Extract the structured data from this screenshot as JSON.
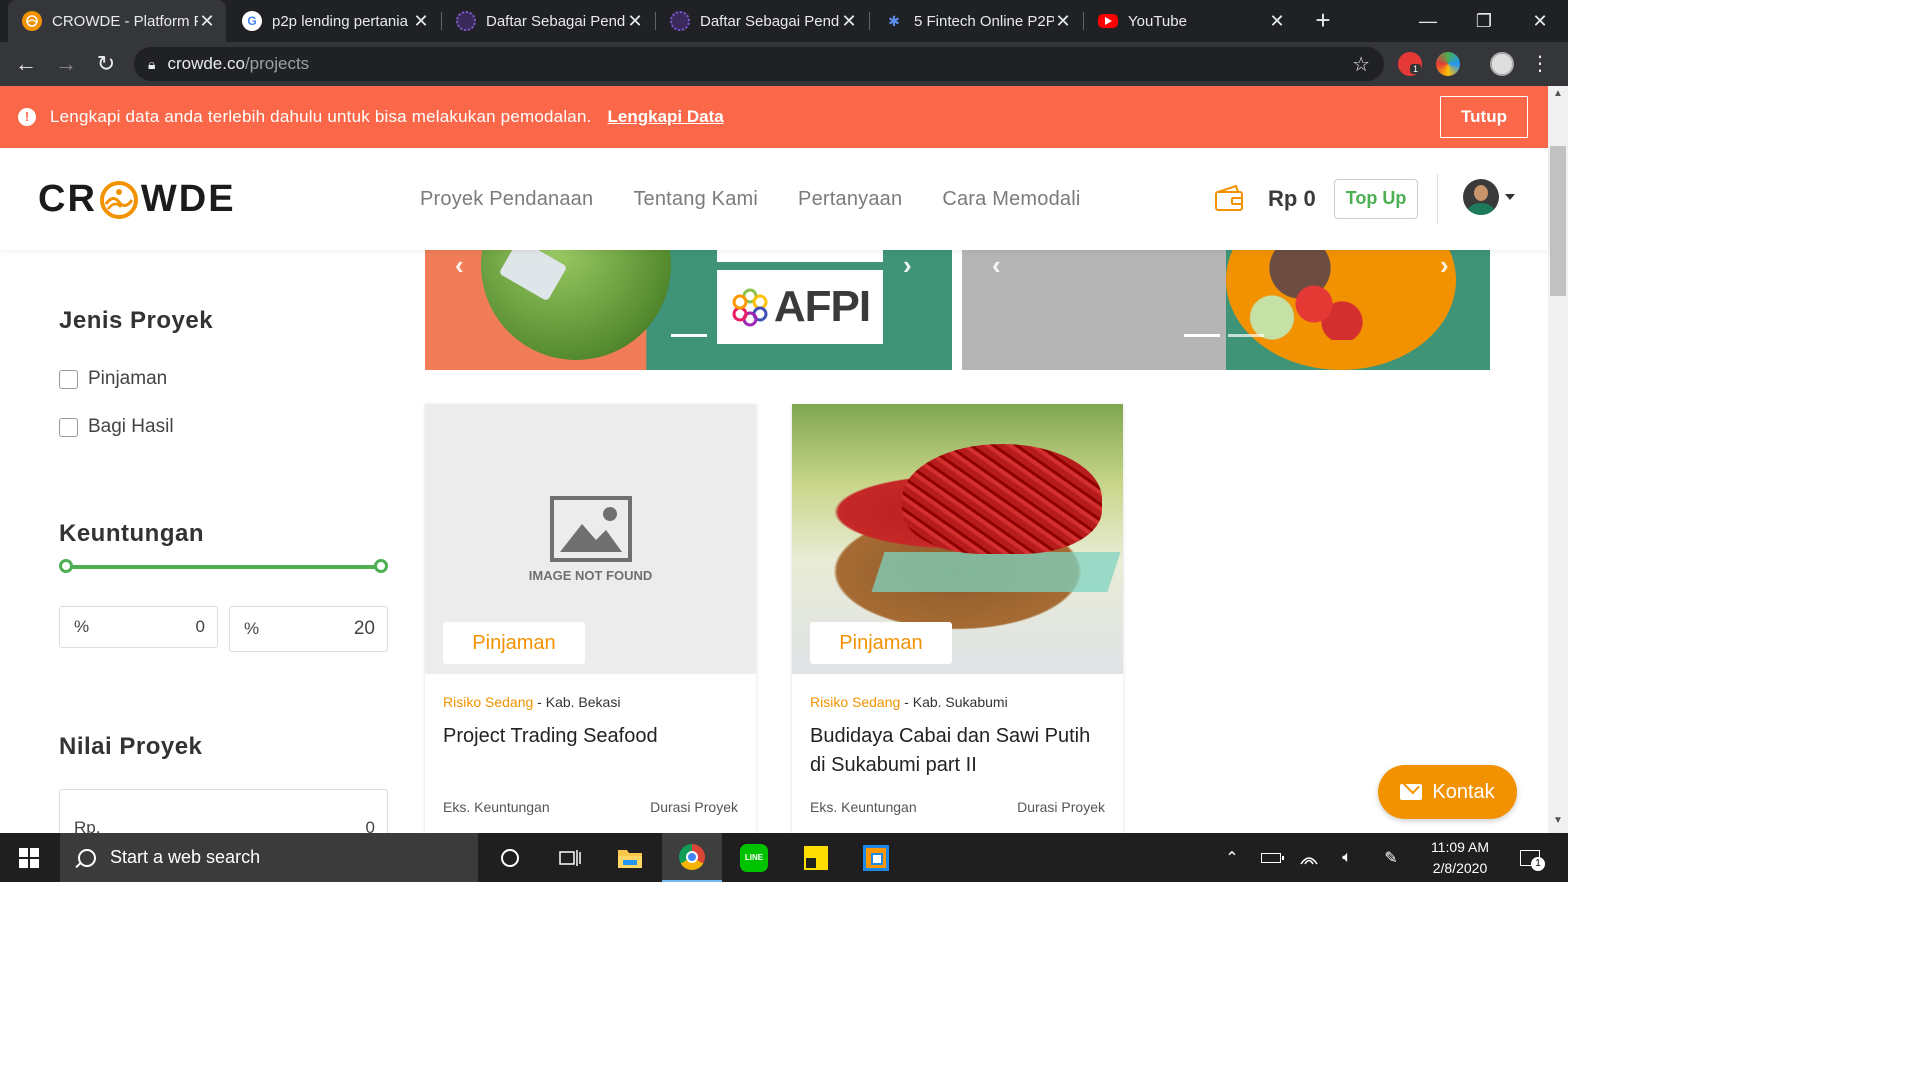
{
  "browser": {
    "tabs": [
      {
        "title": "CROWDE - Platform P",
        "icon": "crowde-favicon",
        "active": true
      },
      {
        "title": "p2p lending pertania",
        "icon": "google-icon",
        "active": false
      },
      {
        "title": "Daftar Sebagai Penda",
        "icon": "globe-icon",
        "active": false
      },
      {
        "title": "Daftar Sebagai Penda",
        "icon": "globe-icon",
        "active": false
      },
      {
        "title": "5 Fintech Online P2P",
        "icon": "fintech-icon",
        "active": false
      },
      {
        "title": "YouTube",
        "icon": "youtube-icon",
        "active": false
      }
    ],
    "url_host": "crowde.co",
    "url_path": "/projects",
    "extension_badge": "1"
  },
  "alert": {
    "message": "Lengkapi data anda terlebih dahulu untuk bisa melakukan pemodalan.",
    "link": "Lengkapi Data",
    "close": "Tutup"
  },
  "header": {
    "logo_left": "CR",
    "logo_right": "WDE",
    "nav": [
      "Proyek Pendanaan",
      "Tentang Kami",
      "Pertanyaan",
      "Cara Memodali"
    ],
    "balance": "Rp 0",
    "topup": "Top Up"
  },
  "filters": {
    "jenis_title": "Jenis Proyek",
    "jenis_options": [
      "Pinjaman",
      "Bagi Hasil"
    ],
    "keuntungan_title": "Keuntungan",
    "keuntungan_range": {
      "min": 0,
      "max": 20
    },
    "keuntungan_prefix": "%",
    "keuntungan_min_text": "0",
    "keuntungan_max_text": "20",
    "nilai_title": "Nilai Proyek",
    "nilai_prefix": "Rp.",
    "nilai_value": "0"
  },
  "banners": {
    "afpi_text": "AFPI"
  },
  "projects": [
    {
      "image": "image-not-found",
      "image_placeholder_text": "IMAGE NOT FOUND",
      "type": "Pinjaman",
      "risk": "Risiko Sedang",
      "location": "Kab. Bekasi",
      "title": "Project Trading Seafood",
      "profit_label": "Eks. Keuntungan",
      "duration_label": "Durasi Proyek"
    },
    {
      "image": "red-chili-basket-photo",
      "type": "Pinjaman",
      "risk": "Risiko Sedang",
      "location": "Kab. Sukabumi",
      "title": "Budidaya Cabai dan Sawi Putih di Sukabumi part II",
      "profit_label": "Eks. Keuntungan",
      "duration_label": "Durasi Proyek"
    }
  ],
  "kontak": "Kontak",
  "taskbar": {
    "search_placeholder": "Start a web search",
    "time": "11:09 AM",
    "date": "2/8/2020",
    "notification_count": "1"
  },
  "colors": {
    "alert": "#fa6749",
    "accent_orange": "#f39200",
    "accent_green": "#4caf50",
    "banner_teal": "#3f9478",
    "banner_orange": "#f07d58"
  }
}
